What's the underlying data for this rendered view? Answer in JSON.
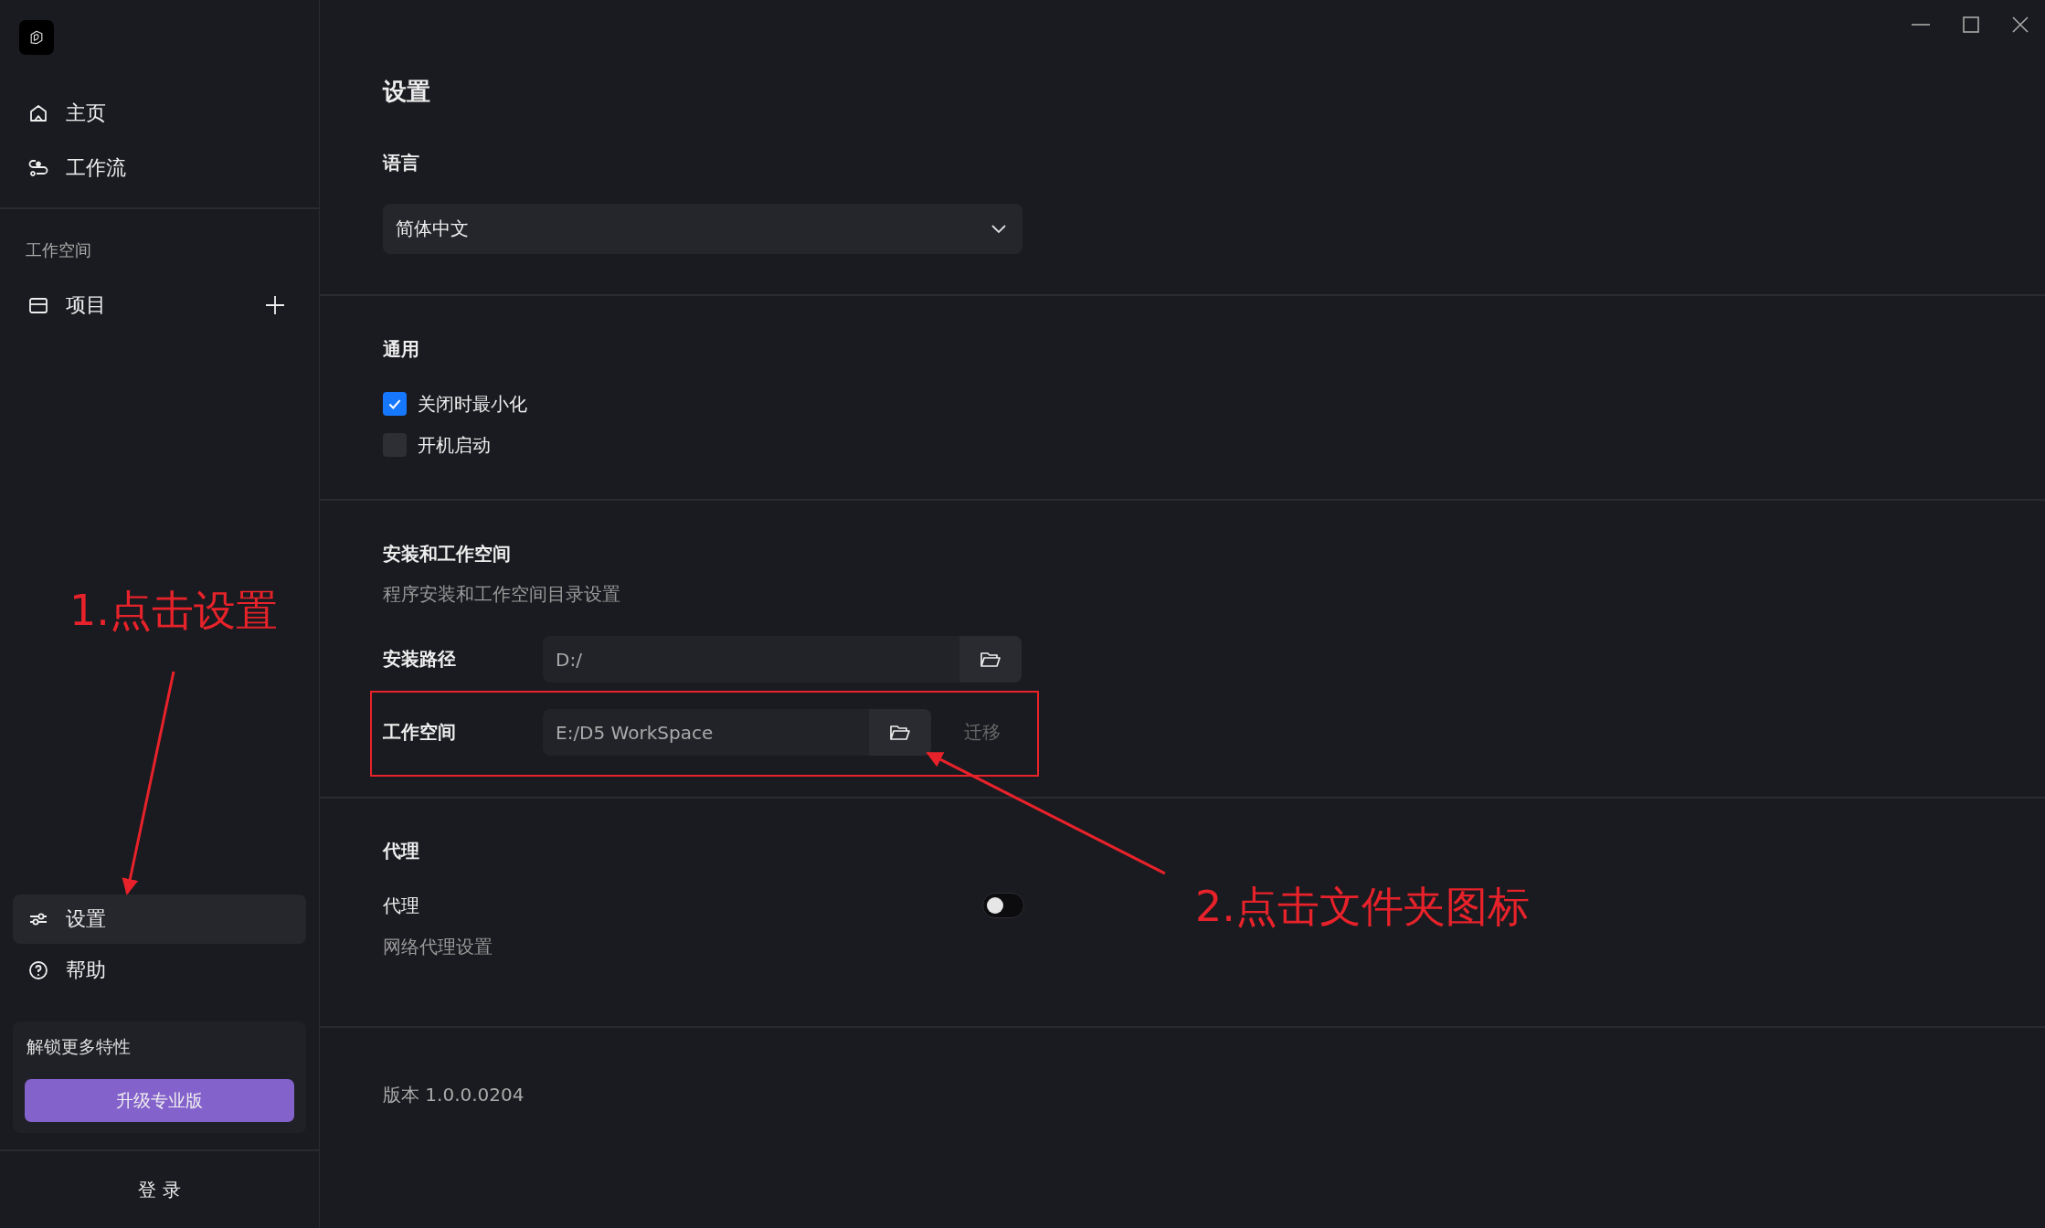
{
  "sidebar": {
    "nav": [
      {
        "label": "主页",
        "selected": false
      },
      {
        "label": "工作流",
        "selected": false
      }
    ],
    "workspace_label": "工作空间",
    "workspace_items": [
      {
        "label": "项目"
      }
    ],
    "bottom_nav": [
      {
        "label": "设置",
        "selected": true
      },
      {
        "label": "帮助",
        "selected": false
      }
    ],
    "upgrade_card": {
      "text": "解锁更多特性",
      "button": "升级专业版"
    },
    "login": "登 录"
  },
  "settings": {
    "title": "设置",
    "language": {
      "heading": "语言",
      "value": "简体中文"
    },
    "general": {
      "heading": "通用",
      "options": [
        {
          "label": "关闭时最小化",
          "checked": true
        },
        {
          "label": "开机启动",
          "checked": false
        }
      ]
    },
    "install": {
      "heading": "安装和工作空间",
      "description": "程序安装和工作空间目录设置",
      "rows": [
        {
          "label": "安装路径",
          "value": "D:/"
        },
        {
          "label": "工作空间",
          "value": "E:/D5 WorkSpace",
          "action": "迁移"
        }
      ]
    },
    "proxy": {
      "heading": "代理",
      "label": "代理",
      "description": "网络代理设置",
      "on": false
    },
    "version": "版本 1.0.0.0204"
  },
  "annotations": [
    {
      "text": "1.点击设置"
    },
    {
      "text": "2.点击文件夹图标"
    }
  ]
}
